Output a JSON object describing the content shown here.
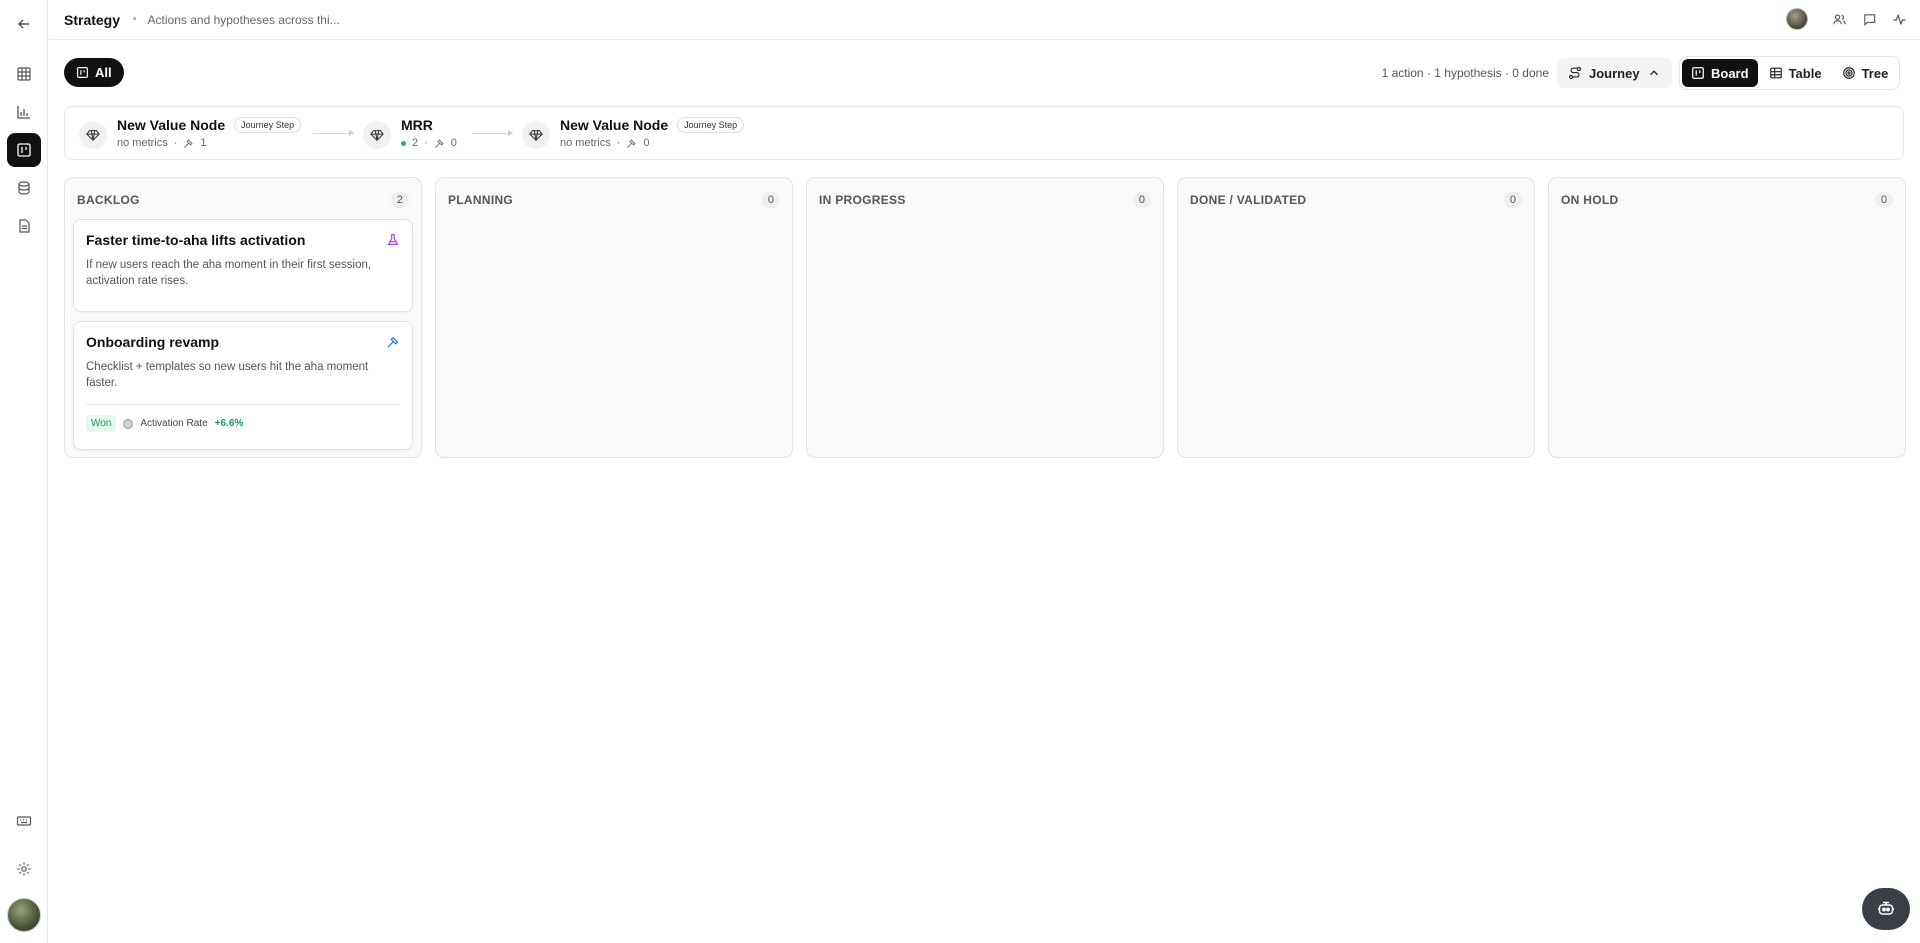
{
  "header": {
    "title": "Strategy",
    "subtitle": "Actions and hypotheses across thi..."
  },
  "toolbar": {
    "filter_all_label": "All",
    "summary": "1 action · 1 hypothesis · 0 done",
    "journey_label": "Journey",
    "views": [
      "Board",
      "Table",
      "Tree"
    ],
    "active_view": "Board"
  },
  "journey": {
    "nodes": [
      {
        "title": "New Value Node",
        "badge": "Journey Step",
        "metrics": "no metrics",
        "actions": "1"
      },
      {
        "title": "MRR",
        "badge": "",
        "metrics": "2",
        "actions": "0"
      },
      {
        "title": "New Value Node",
        "badge": "Journey Step",
        "metrics": "no metrics",
        "actions": "0"
      }
    ]
  },
  "board": {
    "columns": [
      {
        "name": "BACKLOG",
        "count": "2"
      },
      {
        "name": "PLANNING",
        "count": "0"
      },
      {
        "name": "IN PROGRESS",
        "count": "0"
      },
      {
        "name": "DONE / VALIDATED",
        "count": "0"
      },
      {
        "name": "ON HOLD",
        "count": "0"
      }
    ],
    "cards": [
      {
        "title": "Faster time-to-aha lifts activation",
        "description": "If new users reach the aha moment in their first session, activation rate rises.",
        "type_icon": "flask-icon",
        "icon_color": "#a24bd6"
      },
      {
        "title": "Onboarding revamp",
        "description": "Checklist + templates so new users hit the aha moment faster.",
        "type_icon": "hammer-icon",
        "icon_color": "#2f6fd6",
        "status": "Won",
        "metric": "Activation Rate",
        "delta": "+6.6%"
      }
    ]
  },
  "colors": {
    "accent_dark": "#111111",
    "won_green": "#17975f",
    "metric_dot": "#17b38a"
  }
}
